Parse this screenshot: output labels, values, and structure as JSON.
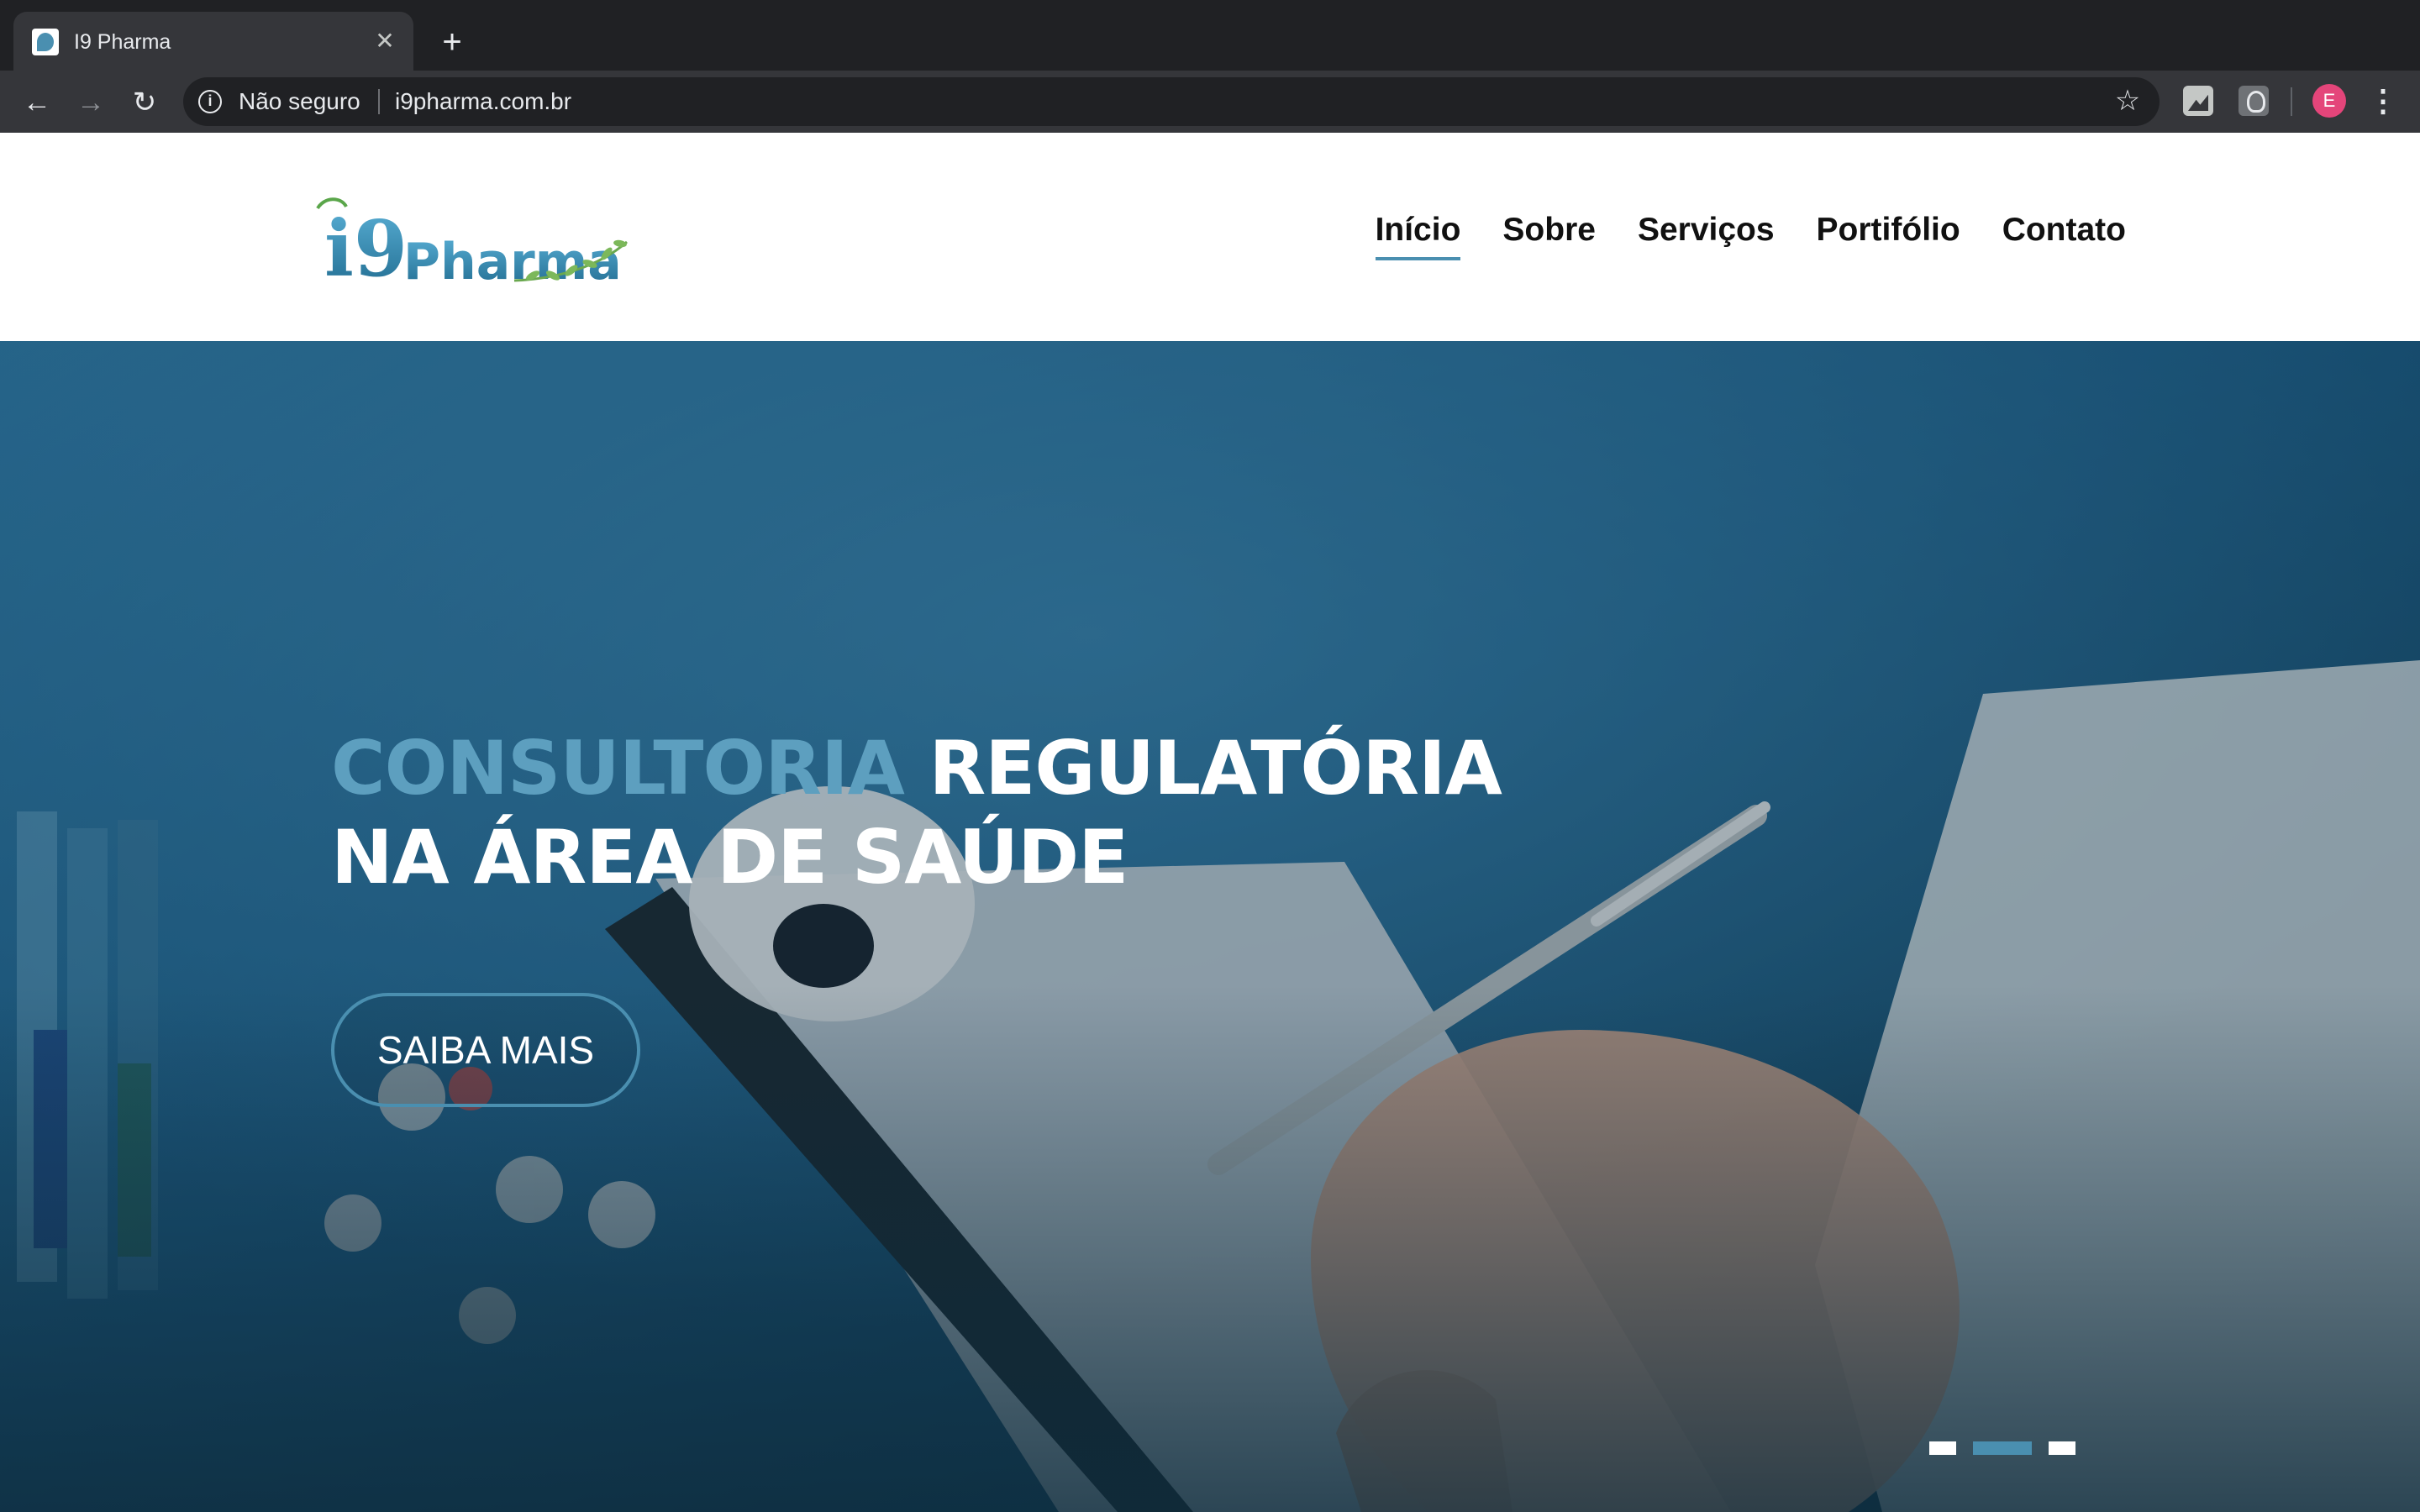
{
  "browser": {
    "tab_title": "I9 Pharma",
    "tab_close": "✕",
    "new_tab": "+",
    "back": "←",
    "forward": "→",
    "reload": "↻",
    "info": "i",
    "security_label": "Não seguro",
    "url": "i9pharma.com.br",
    "bookmark": "☆",
    "profile_initial": "E",
    "menu": "⋮"
  },
  "site": {
    "logo": {
      "mark": "i9",
      "text": "Pharma"
    },
    "nav": [
      {
        "label": "Início",
        "active": true
      },
      {
        "label": "Sobre",
        "active": false
      },
      {
        "label": "Serviços",
        "active": false
      },
      {
        "label": "Portifólio",
        "active": false
      },
      {
        "label": "Contato",
        "active": false
      }
    ]
  },
  "hero": {
    "title_accent": "CONSULTORIA",
    "title_rest": " REGULATÓRIA",
    "title_line2": "NA ÁREA DE SAÚDE",
    "cta_label": "SAIBA MAIS",
    "slides_count": 3,
    "active_slide": 2
  },
  "colors": {
    "accent": "#4a8fb0",
    "accent_text": "#5d9fbf",
    "chrome_dark": "#202124",
    "chrome_toolbar": "#35363a",
    "avatar": "#e4457a"
  }
}
